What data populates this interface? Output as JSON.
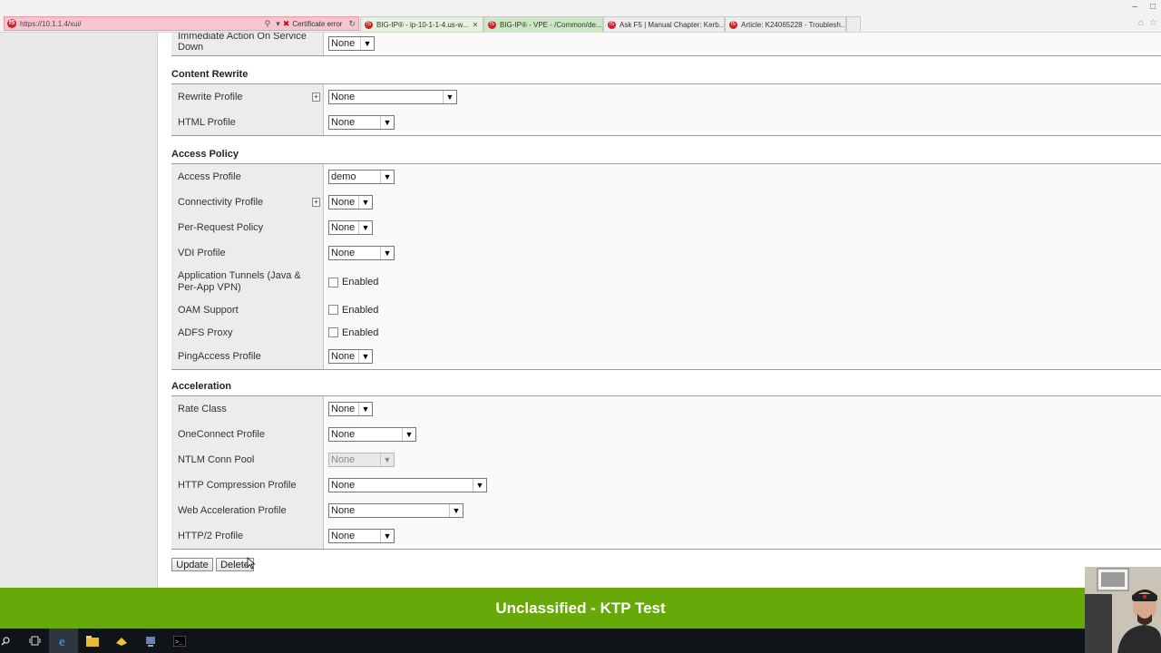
{
  "browser": {
    "url": "https://10.1.1.4/xui/",
    "cert_label": "Certificate error",
    "tabs": [
      {
        "label": "BIG-IP® - ip-10-1-1-4.us-w...",
        "closable": true
      },
      {
        "label": "BIG-IP® - VPE - /Common/de..."
      },
      {
        "label": "Ask F5 | Manual Chapter: Kerb..."
      },
      {
        "label": "Article: K24065228 - Troublesh..."
      }
    ],
    "f5_glyph": "f5"
  },
  "top_partial": {
    "label_line1": "Immediate Action On Service",
    "label_line2": "Down",
    "value": "None"
  },
  "sections": {
    "content_rewrite": {
      "title": "Content Rewrite",
      "rows": [
        {
          "label": "Rewrite Profile",
          "value": "None"
        },
        {
          "label": "HTML Profile",
          "value": "None"
        }
      ]
    },
    "access_policy": {
      "title": "Access Policy",
      "rows": [
        {
          "label": "Access Profile",
          "value": "demo"
        },
        {
          "label": "Connectivity Profile",
          "value": "None"
        },
        {
          "label": "Per-Request Policy",
          "value": "None"
        },
        {
          "label": "VDI Profile",
          "value": "None"
        },
        {
          "label": "Application Tunnels (Java & Per-App VPN)",
          "value": "Enabled"
        },
        {
          "label": "OAM Support",
          "value": "Enabled"
        },
        {
          "label": "ADFS Proxy",
          "value": "Enabled"
        },
        {
          "label": "PingAccess Profile",
          "value": "None"
        }
      ]
    },
    "acceleration": {
      "title": "Acceleration",
      "rows": [
        {
          "label": "Rate Class",
          "value": "None"
        },
        {
          "label": "OneConnect Profile",
          "value": "None"
        },
        {
          "label": "NTLM Conn Pool",
          "value": "None"
        },
        {
          "label": "HTTP Compression Profile",
          "value": "None"
        },
        {
          "label": "Web Acceleration Profile",
          "value": "None"
        },
        {
          "label": "HTTP/2 Profile",
          "value": "None"
        }
      ]
    }
  },
  "buttons": {
    "update": "Update",
    "delete": "Delete"
  },
  "banner": {
    "text": "Unclassified - KTP Test",
    "color": "#68a90a"
  },
  "icons": {
    "plus": "+",
    "dropdown": "▼",
    "close": "✕",
    "search": "⌕"
  }
}
